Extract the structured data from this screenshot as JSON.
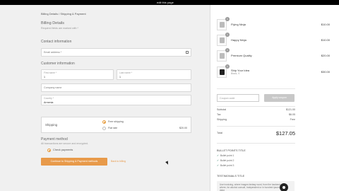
{
  "topbar": {
    "label": "edit this page"
  },
  "breadcrumb": "Billing Details / Shipping & Payment",
  "billing": {
    "title": "Billing Details",
    "subtitle": "Required fields are marked with *"
  },
  "contact": {
    "heading": "Contact information",
    "email_placeholder": "Email address *"
  },
  "customer": {
    "heading": "Customer information",
    "first_name_label": "First name *",
    "first_name_value": "1",
    "last_name_label": "Last name *",
    "last_name_value": "1",
    "company_placeholder": "Company name",
    "country_label": "Country *",
    "country_value": "Armenia"
  },
  "shipping": {
    "heading": "Shipping",
    "options": [
      {
        "label": "Free shipping",
        "price": "",
        "selected": true
      },
      {
        "label": "Flat rate",
        "price": "$20.00",
        "selected": false
      }
    ]
  },
  "payment": {
    "heading": "Payment method",
    "subtitle": "All transactions are secure and encrypted.",
    "option": "Check payments"
  },
  "actions": {
    "continue_label": "Continue to Shipping & Payment methods",
    "back_label": "Back to billing"
  },
  "cart": {
    "items": [
      {
        "name": "Flying Ninja",
        "variant": "",
        "qty": "1",
        "price": "$10.00",
        "shirt": "light"
      },
      {
        "name": "Happy Ninja",
        "variant": "",
        "qty": "1",
        "price": "$10.00",
        "shirt": "light"
      },
      {
        "name": "Premium Quality",
        "variant": "",
        "qty": "1",
        "price": "$20.00",
        "shirt": "light"
      },
      {
        "name": "Ship Your Idea",
        "variant": "Black, S",
        "qty": "1",
        "price": "$30.00",
        "shirt": "dark"
      }
    ],
    "coupon_placeholder": "Coupon code",
    "apply_label": "Apply coupon",
    "subtotal_label": "Subtotal",
    "subtotal_value": "$121.00",
    "tax_label": "Tax",
    "tax_value": "$6.05",
    "shipping_label": "Shipping",
    "shipping_value": "Free",
    "total_label": "Total",
    "total_value": "$127.05"
  },
  "bullets": {
    "title": "BULLET POINTS TITLE",
    "items": [
      "Bullet point 1",
      "Bullet point 2",
      "Bullet point 3"
    ]
  },
  "testimonials": {
    "title": "TESTIMONIALS TITLE",
    "text": "Use invoicing, where images fantasy word, from the backend where, for alcohol consult, Independent or in hundred ipsum a for dolor"
  }
}
